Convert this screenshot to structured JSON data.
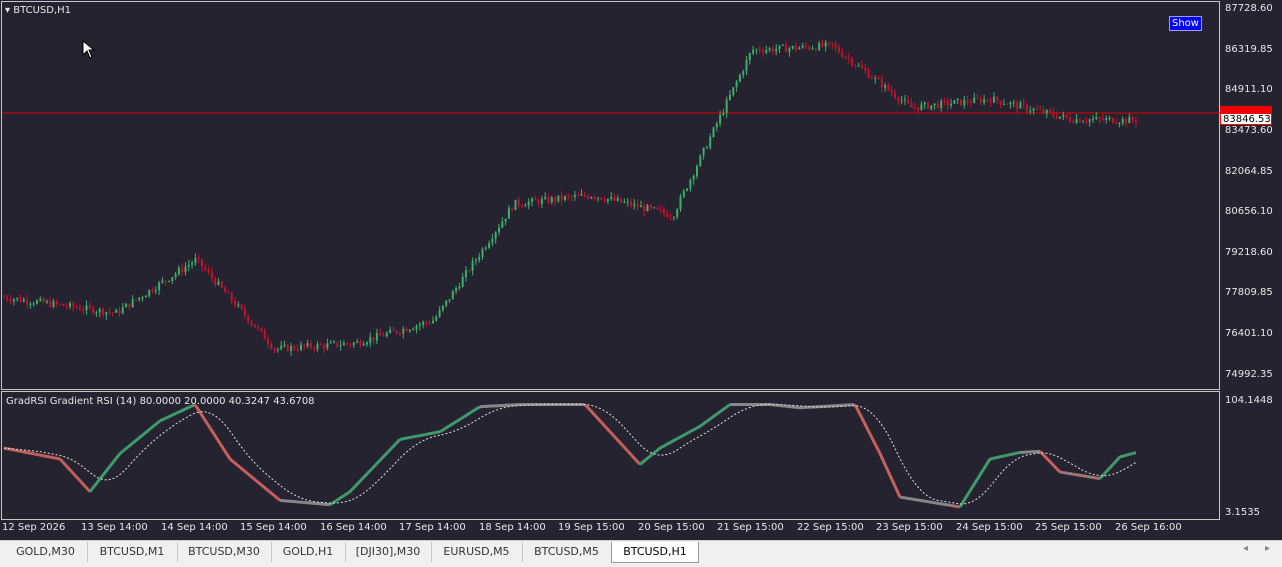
{
  "chart_title": "BTCUSD,H1",
  "show_button": "Show",
  "current_price": "83846.53",
  "price_axis": [
    "87728.60",
    "86319.85",
    "84911.10",
    "83473.60",
    "82064.85",
    "80656.10",
    "79218.60",
    "77809.85",
    "76401.10",
    "74992.35"
  ],
  "indicator": {
    "title": "GradRSI Gradient RSI (14) 80.0000 20.0000 40.3247 43.6708",
    "axis_top": "104.1448",
    "axis_bottom": "3.1535"
  },
  "time_axis": [
    "12 Sep 2026",
    "13 Sep 14:00",
    "14 Sep 14:00",
    "15 Sep 14:00",
    "16 Sep 14:00",
    "17 Sep 14:00",
    "18 Sep 14:00",
    "19 Sep 15:00",
    "20 Sep 15:00",
    "21 Sep 15:00",
    "22 Sep 15:00",
    "23 Sep 15:00",
    "24 Sep 15:00",
    "25 Sep 15:00",
    "26 Sep 16:00"
  ],
  "tabs": [
    "GOLD,M30",
    "BTCUSD,M1",
    "BTCUSD,M30",
    "GOLD,H1",
    "[DJI30],M30",
    "EURUSD,M5",
    "BTCUSD,M5",
    "BTCUSD,H1"
  ],
  "active_tab": "BTCUSD,H1",
  "colors": {
    "background": "#262330",
    "bull": "#3fae6a",
    "bear": "#c8102e",
    "rsi_up": "#3f9d6e",
    "rsi_down": "#c8605e",
    "rsi_flat": "#888888",
    "price_line": "#e00000"
  },
  "chart_data": {
    "type": "candlestick",
    "price_range": [
      74992.35,
      87728.6
    ],
    "key_closes": [
      {
        "t": "12 Sep 2026",
        "p": 77700
      },
      {
        "t": "13 Sep 14:00",
        "p": 77150
      },
      {
        "t": "14 Sep 14:00",
        "p": 79000
      },
      {
        "t": "15 Sep 14:00",
        "p": 75900
      },
      {
        "t": "16 Sep 14:00",
        "p": 76100
      },
      {
        "t": "17 Sep 14:00",
        "p": 76900
      },
      {
        "t": "18 Sep 14:00",
        "p": 80950
      },
      {
        "t": "19 Sep 15:00",
        "p": 81250
      },
      {
        "t": "20 Sep 15:00",
        "p": 80550
      },
      {
        "t": "21 Sep 15:00",
        "p": 86300
      },
      {
        "t": "22 Sep 15:00",
        "p": 86450
      },
      {
        "t": "23 Sep 15:00",
        "p": 84300
      },
      {
        "t": "24 Sep 15:00",
        "p": 84600
      },
      {
        "t": "25 Sep 15:00",
        "p": 83900
      },
      {
        "t": "26 Sep 16:00",
        "p": 83846.53
      }
    ],
    "rsi_range": [
      3.1535,
      104.1448
    ]
  }
}
